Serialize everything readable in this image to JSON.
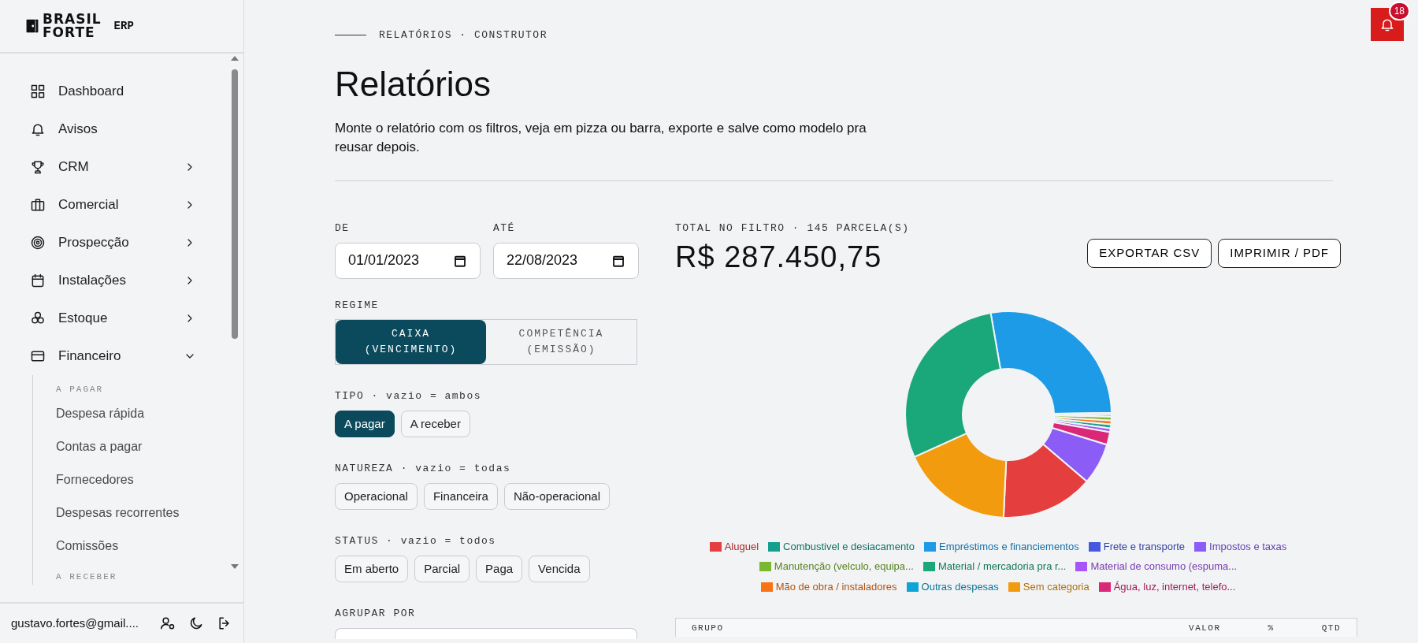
{
  "sidebar": {
    "logo": {
      "line1": "BRASIL",
      "line2": "FORTE",
      "suffix": "ERP"
    },
    "items": [
      {
        "label": "Dashboard",
        "expandable": false
      },
      {
        "label": "Avisos",
        "expandable": false
      },
      {
        "label": "CRM",
        "expandable": true,
        "expanded": false
      },
      {
        "label": "Comercial",
        "expandable": true,
        "expanded": false
      },
      {
        "label": "Prospecção",
        "expandable": true,
        "expanded": false
      },
      {
        "label": "Instalações",
        "expandable": true,
        "expanded": false
      },
      {
        "label": "Estoque",
        "expandable": true,
        "expanded": false
      },
      {
        "label": "Financeiro",
        "expandable": true,
        "expanded": true,
        "sections": [
          {
            "heading": "A PAGAR",
            "items": [
              "Despesa rápida",
              "Contas a pagar",
              "Fornecedores",
              "Despesas recorrentes",
              "Comissões"
            ]
          },
          {
            "heading": "A RECEBER"
          }
        ]
      }
    ],
    "footer": {
      "email": "gustavo.fortes@gmail...."
    }
  },
  "notifications": {
    "count": "18"
  },
  "breadcrumb": "RELATÓRIOS · CONSTRUTOR",
  "title": "Relatórios",
  "description": "Monte o relatório com os filtros, veja em pizza ou barra, exporte e salve como modelo pra reusar depois.",
  "filters": {
    "date_from": {
      "label": "DE",
      "value": "01/01/2023"
    },
    "date_to": {
      "label": "ATÉ",
      "value": "22/08/2023"
    },
    "regime": {
      "label": "REGIME",
      "options": [
        {
          "label": "CAIXA\n(VENCIMENTO)",
          "selected": true
        },
        {
          "label": "COMPETÊNCIA\n(EMISSÃO)",
          "selected": false
        }
      ]
    },
    "groups": [
      {
        "label": "TIPO · vazio = ambos",
        "options": [
          {
            "label": "A pagar",
            "selected": true
          },
          {
            "label": "A receber",
            "selected": false
          }
        ]
      },
      {
        "label": "NATUREZA · vazio = todas",
        "options": [
          {
            "label": "Operacional",
            "selected": false
          },
          {
            "label": "Financeira",
            "selected": false
          },
          {
            "label": "Não-operacional",
            "selected": false
          }
        ]
      },
      {
        "label": "STATUS · vazio = todos",
        "options": [
          {
            "label": "Em aberto",
            "selected": false
          },
          {
            "label": "Parcial",
            "selected": false
          },
          {
            "label": "Paga",
            "selected": false
          },
          {
            "label": "Vencida",
            "selected": false
          }
        ]
      }
    ],
    "group_by": {
      "label": "AGRUPAR POR"
    }
  },
  "summary": {
    "label": "TOTAL NO FILTRO · 145 PARCELA(S)",
    "total": "R$ 287.450,75",
    "buttons": [
      "EXPORTAR CSV",
      "IMPRIMIR / PDF"
    ]
  },
  "chart": {
    "legend": [
      {
        "label": "Aluguel",
        "color": "#e53e3e"
      },
      {
        "label": "Combustivel e desiacamento",
        "color": "#14a08f"
      },
      {
        "label": "Empréstimos e financiementos",
        "color": "#1e9be6"
      },
      {
        "label": "Frete e transporte",
        "color": "#4758e0"
      },
      {
        "label": "Impostos e taxas",
        "color": "#8b5cf6"
      },
      {
        "label": "Manutenção (velculo, equipa...",
        "color": "#7cb82f"
      },
      {
        "label": "Material / mercadoria pra r...",
        "color": "#1aa77a"
      },
      {
        "label": "Material de consumo (espuma...",
        "color": "#a855f7"
      },
      {
        "label": "Mão de obra / instaladores",
        "color": "#f97316"
      },
      {
        "label": "Outras despesas",
        "color": "#0ea5d6"
      },
      {
        "label": "Sem categoria",
        "color": "#f29b0f"
      },
      {
        "label": "Água, luz, internet, telefo...",
        "color": "#db2777"
      }
    ]
  },
  "table": {
    "columns": [
      "GRUPO",
      "VALOR",
      "%",
      "QTD"
    ]
  }
}
